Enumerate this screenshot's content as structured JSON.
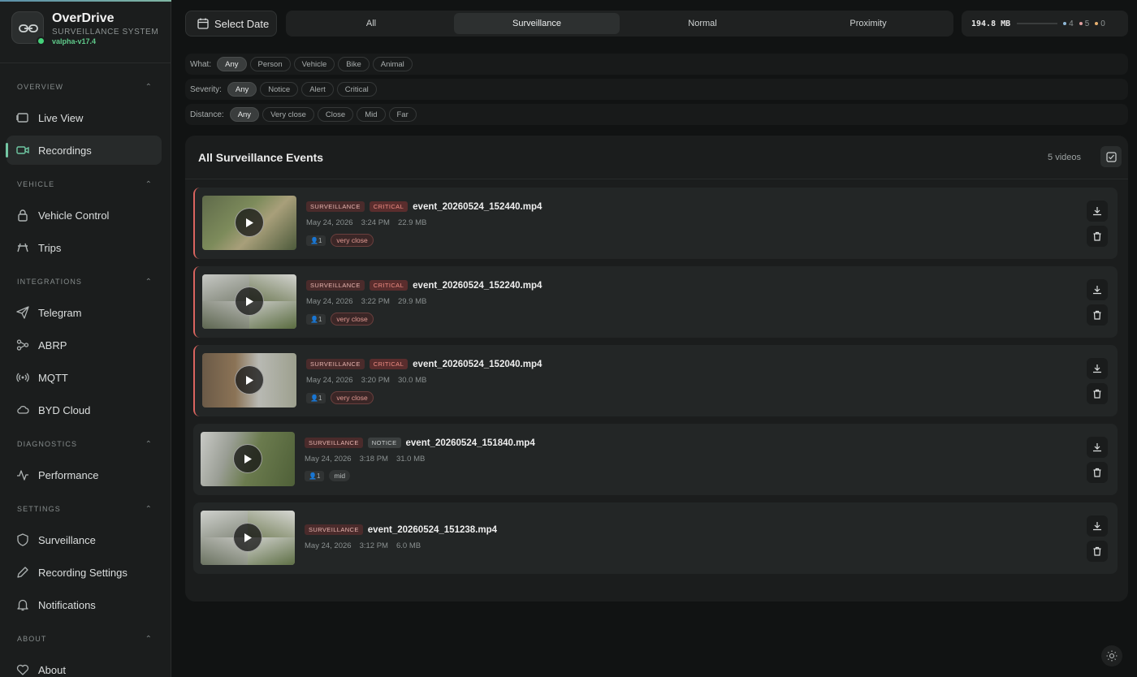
{
  "brand": {
    "title": "OverDrive",
    "subtitle": "SURVEILLANCE SYSTEM",
    "version": "valpha-v17.4"
  },
  "sidebar": {
    "sections": [
      {
        "label": "OVERVIEW",
        "items": [
          {
            "label": "Live View",
            "icon": "live-view-icon"
          },
          {
            "label": "Recordings",
            "icon": "video-camera-icon",
            "active": true
          }
        ]
      },
      {
        "label": "VEHICLE",
        "items": [
          {
            "label": "Vehicle Control",
            "icon": "lock-icon"
          },
          {
            "label": "Trips",
            "icon": "road-icon"
          }
        ]
      },
      {
        "label": "INTEGRATIONS",
        "items": [
          {
            "label": "Telegram",
            "icon": "send-icon"
          },
          {
            "label": "ABRP",
            "icon": "route-icon"
          },
          {
            "label": "MQTT",
            "icon": "signal-icon"
          },
          {
            "label": "BYD Cloud",
            "icon": "cloud-icon"
          }
        ]
      },
      {
        "label": "DIAGNOSTICS",
        "items": [
          {
            "label": "Performance",
            "icon": "activity-icon"
          }
        ]
      },
      {
        "label": "SETTINGS",
        "items": [
          {
            "label": "Surveillance",
            "icon": "shield-icon"
          },
          {
            "label": "Recording Settings",
            "icon": "pencil-icon"
          },
          {
            "label": "Notifications",
            "icon": "bell-icon"
          }
        ]
      },
      {
        "label": "ABOUT",
        "items": [
          {
            "label": "About",
            "icon": "heart-icon"
          }
        ]
      }
    ]
  },
  "toolbar": {
    "select_date": "Select Date",
    "tabs": [
      "All",
      "Surveillance",
      "Normal",
      "Proximity"
    ],
    "active_tab": "Surveillance",
    "storage": "194.8 MB",
    "counts": [
      {
        "value": "4",
        "color": "#8fb8d8"
      },
      {
        "value": "5",
        "color": "#e0a0a0"
      },
      {
        "value": "0",
        "color": "#e8b070"
      }
    ]
  },
  "filters": {
    "what": {
      "label": "What:",
      "options": [
        "Any",
        "Person",
        "Vehicle",
        "Bike",
        "Animal"
      ],
      "active": "Any"
    },
    "severity": {
      "label": "Severity:",
      "options": [
        "Any",
        "Notice",
        "Alert",
        "Critical"
      ],
      "active": "Any"
    },
    "distance": {
      "label": "Distance:",
      "options": [
        "Any",
        "Very close",
        "Close",
        "Mid",
        "Far"
      ],
      "active": "Any"
    }
  },
  "panel": {
    "title": "All Surveillance Events",
    "count": "5 videos",
    "events": [
      {
        "type": "SURVEILLANCE",
        "severity": "CRITICAL",
        "file": "event_20260524_152440.mp4",
        "date": "May 24, 2026",
        "time": "3:24 PM",
        "size": "22.9 MB",
        "persons": "1",
        "distance": "very close"
      },
      {
        "type": "SURVEILLANCE",
        "severity": "CRITICAL",
        "file": "event_20260524_152240.mp4",
        "date": "May 24, 2026",
        "time": "3:22 PM",
        "size": "29.9 MB",
        "persons": "1",
        "distance": "very close"
      },
      {
        "type": "SURVEILLANCE",
        "severity": "CRITICAL",
        "file": "event_20260524_152040.mp4",
        "date": "May 24, 2026",
        "time": "3:20 PM",
        "size": "30.0 MB",
        "persons": "1",
        "distance": "very close"
      },
      {
        "type": "SURVEILLANCE",
        "severity": "NOTICE",
        "file": "event_20260524_151840.mp4",
        "date": "May 24, 2026",
        "time": "3:18 PM",
        "size": "31.0 MB",
        "persons": "1",
        "distance": "mid"
      },
      {
        "type": "SURVEILLANCE",
        "severity": "",
        "file": "event_20260524_151238.mp4",
        "date": "May 24, 2026",
        "time": "3:12 PM",
        "size": "6.0 MB",
        "persons": "",
        "distance": ""
      }
    ]
  }
}
